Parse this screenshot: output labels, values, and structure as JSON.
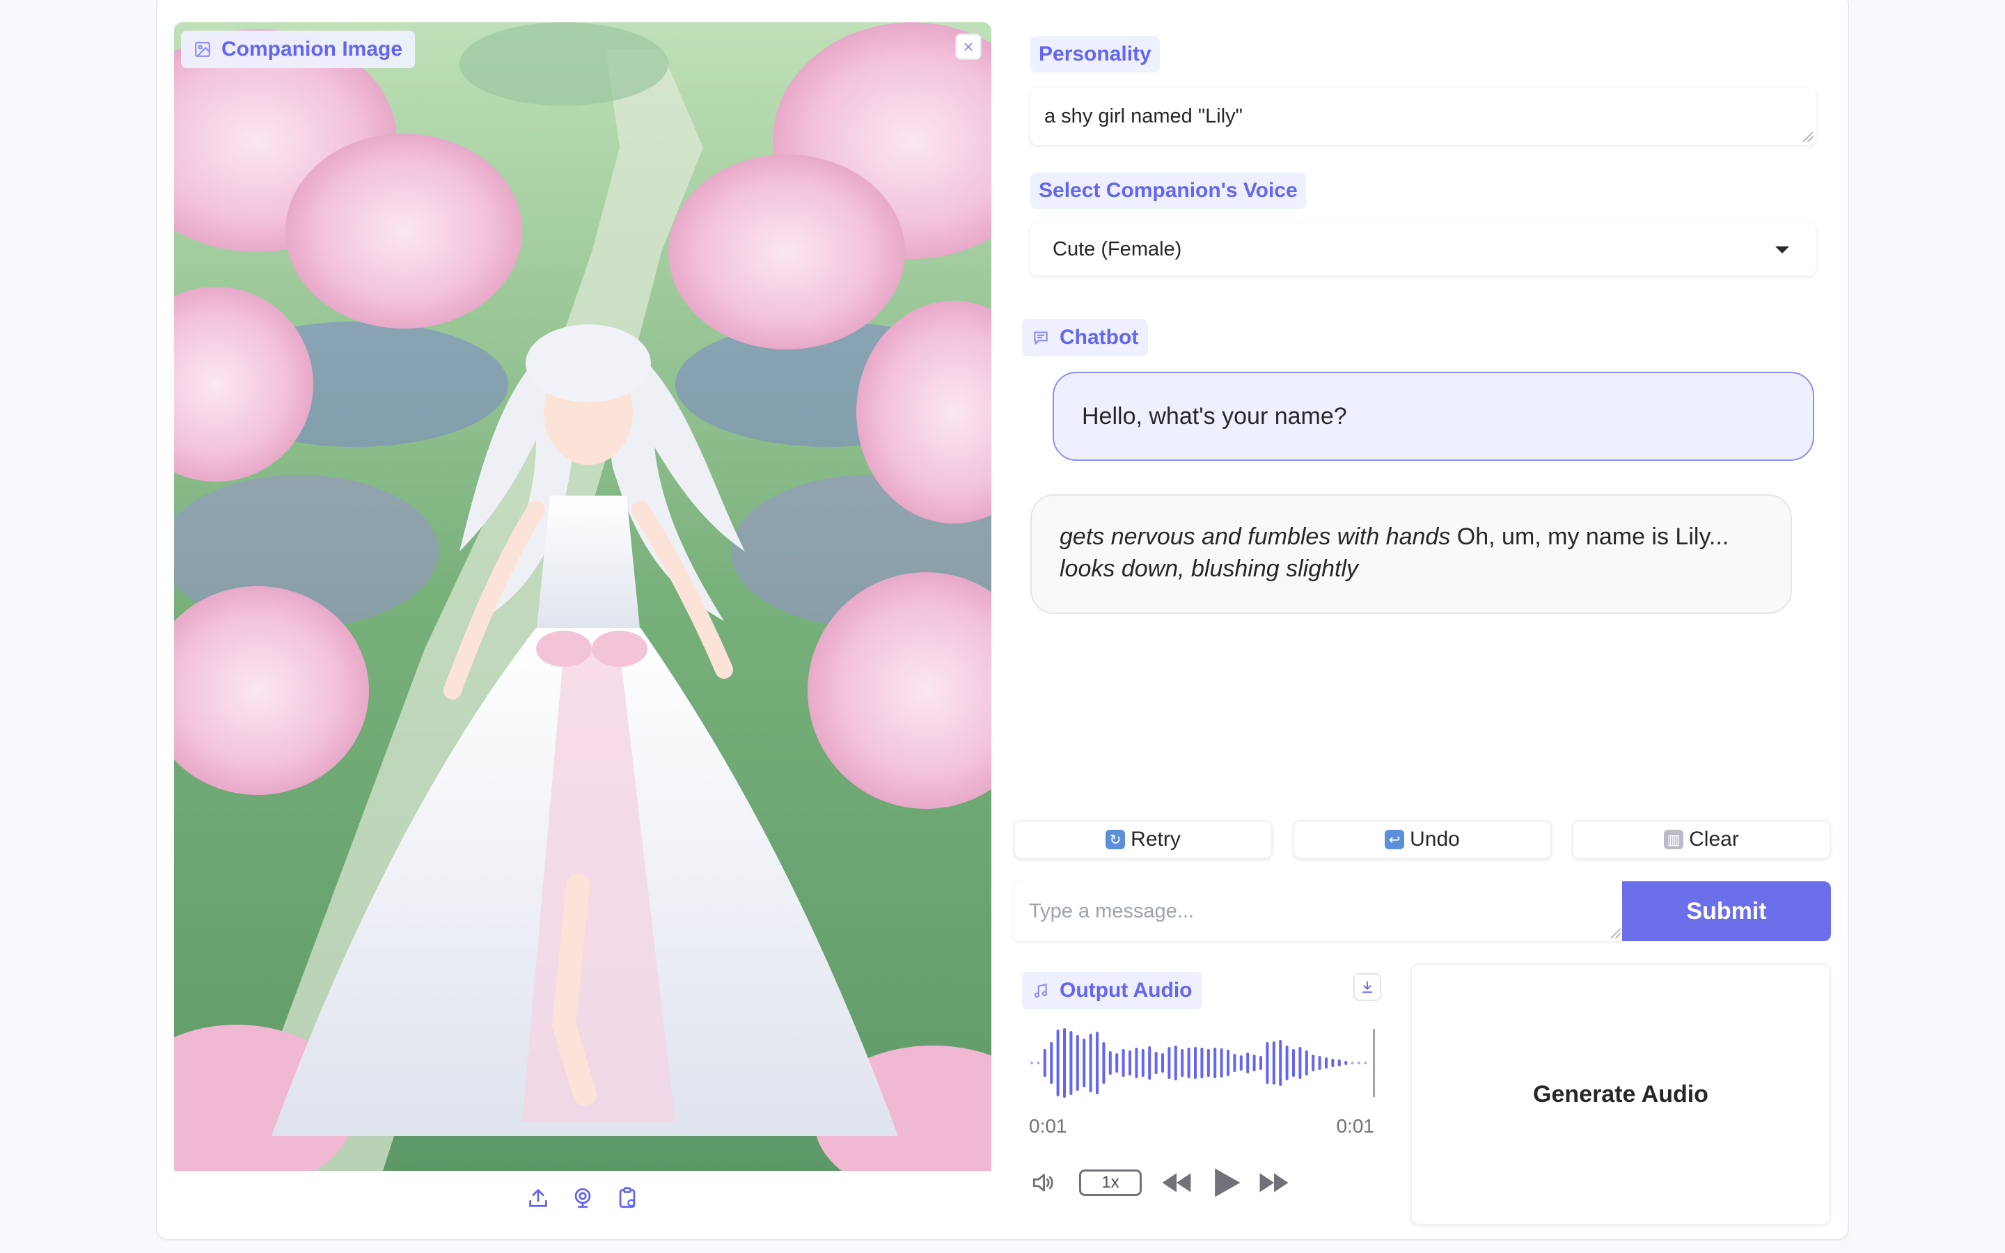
{
  "image_panel": {
    "label": "Companion Image",
    "close_icon": "close-icon",
    "toolbar_icons": [
      "upload-icon",
      "webcam-icon",
      "clipboard-icon"
    ]
  },
  "personality": {
    "label": "Personality",
    "value": "a shy girl named \"Lily\""
  },
  "voice": {
    "label": "Select Companion's Voice",
    "selected": "Cute (Female)"
  },
  "chatbot": {
    "label": "Chatbot",
    "messages": [
      {
        "role": "user",
        "text": "Hello, what's your name?"
      },
      {
        "role": "bot",
        "italic_1": "gets nervous and fumbles with hands",
        "text_1": " Oh, um, my name is Lily... ",
        "italic_2": "looks down, blushing slightly"
      }
    ]
  },
  "actions": {
    "retry": "Retry",
    "undo": "Undo",
    "clear": "Clear"
  },
  "input": {
    "placeholder": "Type a message...",
    "submit": "Submit"
  },
  "audio": {
    "label": "Output Audio",
    "time_current": "0:01",
    "time_total": "0:01",
    "speed": "1x"
  },
  "generate": {
    "label": "Generate Audio"
  },
  "colors": {
    "accent": "#6366f1",
    "accent_bg": "#eef0fd",
    "submit": "#6c6fea"
  }
}
